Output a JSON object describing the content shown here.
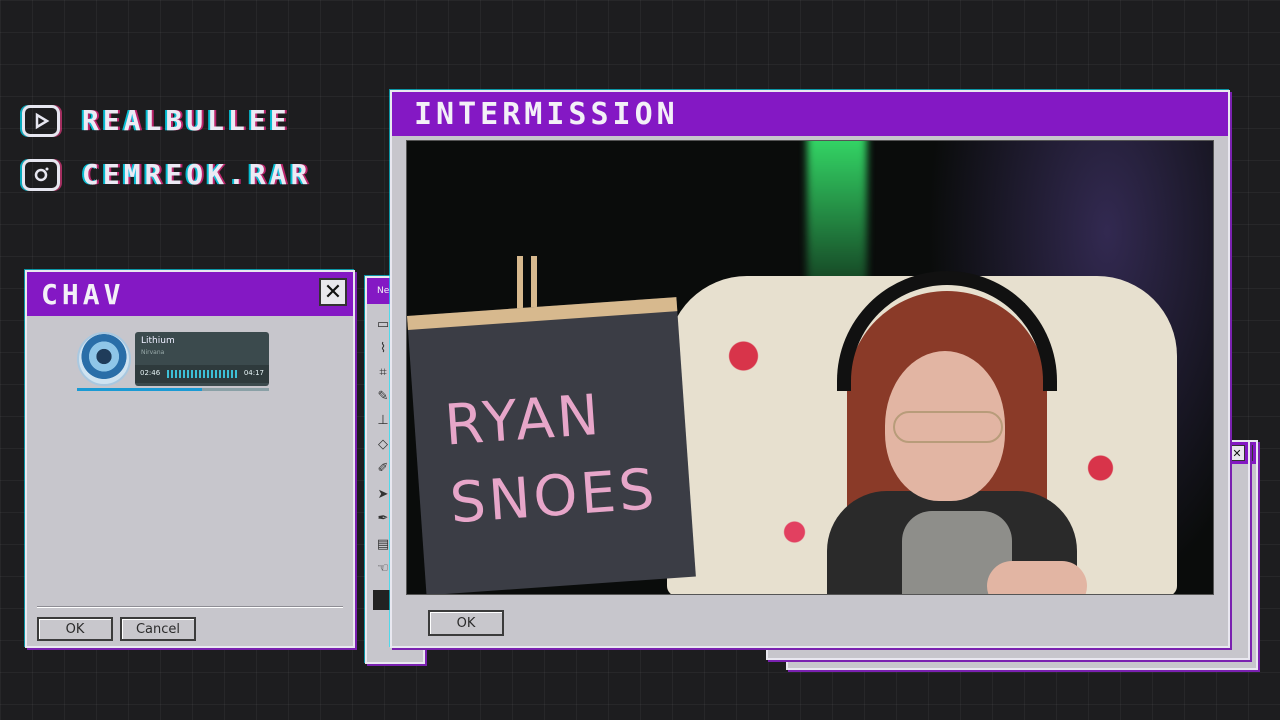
{
  "socials": {
    "youtube": {
      "icon": "youtube-icon",
      "handle": "REALBULLEE"
    },
    "instagram": {
      "icon": "instagram-icon",
      "handle": "CEMREOK.RAR"
    }
  },
  "chat_window": {
    "title": "CHAV",
    "close_label": "✕",
    "ok_label": "OK",
    "cancel_label": "Cancel",
    "now_playing": {
      "title": "Lithium",
      "artist": "Nirvana",
      "current_time": "02:46",
      "duration": "04:17",
      "progress": 0.65
    }
  },
  "toolbar_window": {
    "title": "Ne",
    "tools": [
      "select-tool-icon",
      "lasso-tool-icon",
      "crop-tool-icon",
      "pencil-tool-icon",
      "stamp-tool-icon",
      "eraser-tool-icon",
      "brush-tool-icon",
      "pointer-tool-icon",
      "pen-tool-icon",
      "text-tool-icon",
      "hand-tool-icon"
    ]
  },
  "main_window": {
    "title": "INTERMISSION",
    "ok_label": "OK",
    "board_text": "RYAN SNOES"
  },
  "colors": {
    "titlebar": "#8418c4",
    "window_body": "#c7c6cc",
    "background": "#1d1d1f"
  }
}
